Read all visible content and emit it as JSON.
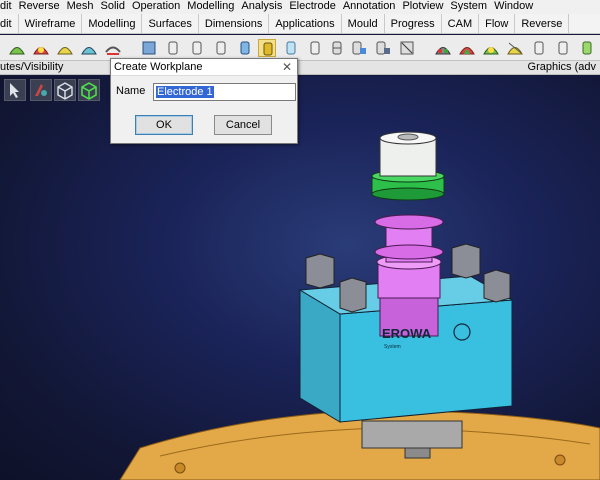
{
  "menu": [
    "dit",
    "Reverse",
    "Mesh",
    "Solid",
    "Operation",
    "Modelling",
    "Analysis",
    "Electrode",
    "Annotation",
    "Plotview",
    "System",
    "Window"
  ],
  "tabs": [
    "Edit",
    "Wireframe",
    "Modelling",
    "Surfaces",
    "Dimensions",
    "Applications",
    "Mould",
    "Progress",
    "CAM",
    "Flow",
    "Reverse"
  ],
  "tabs_visible_first": "dit",
  "toolbar_icons": [
    "face-green-icon",
    "face-red-icon",
    "face-yellow-icon",
    "face-cyan-icon",
    "face-dash-icon",
    "face-arc-icon",
    "rotate-icon",
    "cylinder-icon",
    "cylinder-icon",
    "cylinder-icon",
    "cylinder-blue-icon",
    "cylinder-yellow-icon",
    "cylinder-light-icon",
    "cylinder-icon",
    "cylinder-grid-icon",
    "cylinder-arrows-icon",
    "cylinder-check-icon",
    "cylinder-cross-icon",
    "face-multi-icon",
    "face-stripes-icon",
    "face-green2-icon",
    "face-yellow2-icon",
    "cylinder-icon",
    "cylinder-icon",
    "cylinder-green-icon"
  ],
  "subbar": {
    "left": "utes/Visibility",
    "right": "Graphics (adv"
  },
  "viewport_tools": [
    "pointer-icon",
    "fill-icon",
    "cube-wire-icon",
    "cube-green-icon",
    "cube-shaded-icon"
  ],
  "dialog": {
    "title": "Create Workplane",
    "name_label": "Name",
    "name_value": "Electrode 1",
    "ok_label": "OK",
    "cancel_label": "Cancel"
  },
  "model": {
    "brand": "EROWA",
    "brand_sub": "System"
  },
  "colors": {
    "viewport": "#1a2358",
    "holder": "#33b8d6",
    "electrode": "#dd7ff0",
    "ring": "#2dbf4a",
    "base": "#e0a646"
  }
}
